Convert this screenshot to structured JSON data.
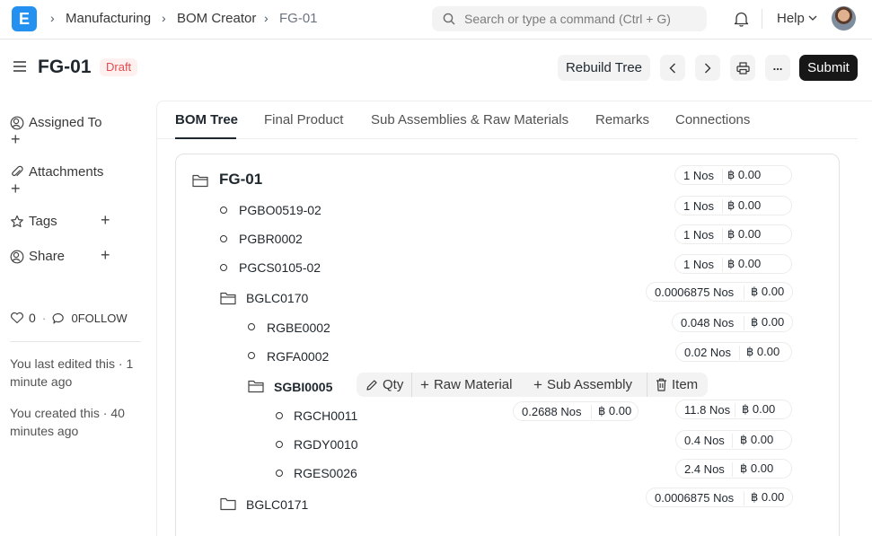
{
  "navbar": {
    "logo": "E",
    "breadcrumbs": [
      "Manufacturing",
      "BOM Creator",
      "FG-01"
    ],
    "search_placeholder": "Search or type a command (Ctrl + G)",
    "help_label": "Help"
  },
  "page": {
    "title": "FG-01",
    "status": "Draft",
    "rebuild_label": "Rebuild Tree",
    "more_label": "...",
    "submit_label": "Submit"
  },
  "sidebar": {
    "assigned_to": "Assigned To",
    "attachments": "Attachments",
    "tags": "Tags",
    "share": "Share",
    "likes": "0",
    "follow": "0FOLLOW",
    "last_edited": "You last edited this · 1 minute ago",
    "created": "You created this · 40 minutes ago"
  },
  "tabs": [
    "BOM Tree",
    "Final Product",
    "Sub Assemblies & Raw Materials",
    "Remarks",
    "Connections"
  ],
  "tree": {
    "root": {
      "name": "FG-01",
      "qty": "1 Nos",
      "rate": "฿ 0.00"
    },
    "items": [
      {
        "name": "PGBO0519-02",
        "qty": "1 Nos",
        "rate": "฿ 0.00"
      },
      {
        "name": "PGBR0002",
        "qty": "1 Nos",
        "rate": "฿ 0.00"
      },
      {
        "name": "PGCS0105-02",
        "qty": "1 Nos",
        "rate": "฿ 0.00"
      },
      {
        "name": "BGLC0170",
        "qty": "0.0006875 Nos",
        "rate": "฿ 0.00"
      },
      {
        "name": "RGBE0002",
        "qty": "0.048 Nos",
        "rate": "฿ 0.00"
      },
      {
        "name": "RGFA0002",
        "qty": "0.02 Nos",
        "rate": "฿ 0.00"
      },
      {
        "name": "SGBI0005",
        "qty": "0.2688 Nos",
        "rate": "฿ 0.00"
      },
      {
        "name": "RGCH0011",
        "qty": "11.8 Nos",
        "rate": "฿ 0.00"
      },
      {
        "name": "RGDY0010",
        "qty": "0.4 Nos",
        "rate": "฿ 0.00"
      },
      {
        "name": "RGES0026",
        "qty": "2.4 Nos",
        "rate": "฿ 0.00"
      },
      {
        "name": "BGLC0171",
        "qty": "0.0006875 Nos",
        "rate": "฿ 0.00"
      }
    ],
    "actions": {
      "qty": "Qty",
      "raw_material": "Raw Material",
      "sub_assembly": "Sub Assembly",
      "item": "Item"
    }
  },
  "colors": {
    "brand": "#2490ef",
    "draft": "#e24c4c",
    "primary_button": "#171717"
  }
}
